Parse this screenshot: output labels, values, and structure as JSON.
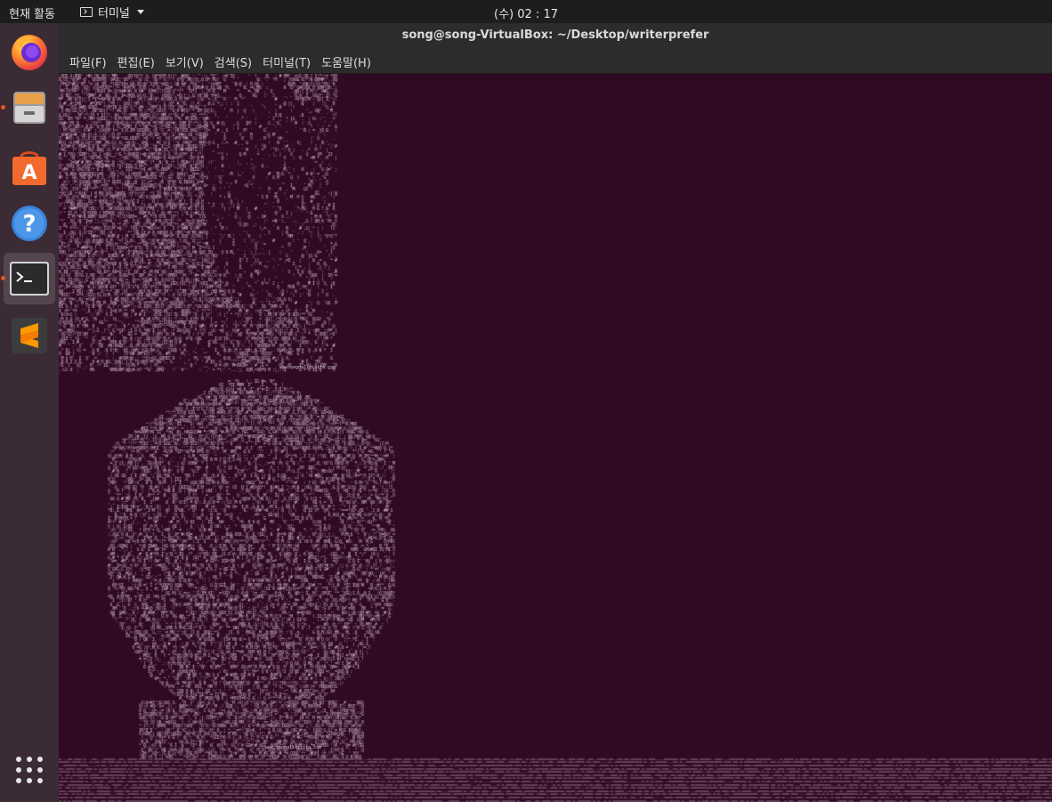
{
  "topbar": {
    "activities_label": "현재 활동",
    "app_menu_label": "터미널",
    "clock": "(수) 02 : 17"
  },
  "dock": {
    "items": [
      {
        "name": "firefox",
        "icon": "firefox-icon",
        "running": false
      },
      {
        "name": "files",
        "icon": "files-icon",
        "running": true
      },
      {
        "name": "software",
        "icon": "software-center-icon",
        "running": false
      },
      {
        "name": "help",
        "icon": "help-icon",
        "running": false
      },
      {
        "name": "terminal",
        "icon": "terminal-icon",
        "running": true,
        "active": true
      },
      {
        "name": "sublime-text",
        "icon": "sublime-text-icon",
        "running": false
      }
    ],
    "show_apps_icon": "show-applications-icon"
  },
  "window": {
    "title": "song@song-VirtualBox: ~/Desktop/writerprefer",
    "menus": [
      "파일(F)",
      "편집(E)",
      "보기(V)",
      "검색(S)",
      "터미널(T)",
      "도움말(H)"
    ],
    "background_color": "#300a24",
    "text_color": "#d9c9d3"
  },
  "ascii_art": {
    "credit_1": "www.segnalidivita.com",
    "credit_2": "www.segnalidivita.com"
  },
  "colors": {
    "topbar": "#1d1d1d",
    "dock": "#3a2b34",
    "accent": "#e95420"
  }
}
